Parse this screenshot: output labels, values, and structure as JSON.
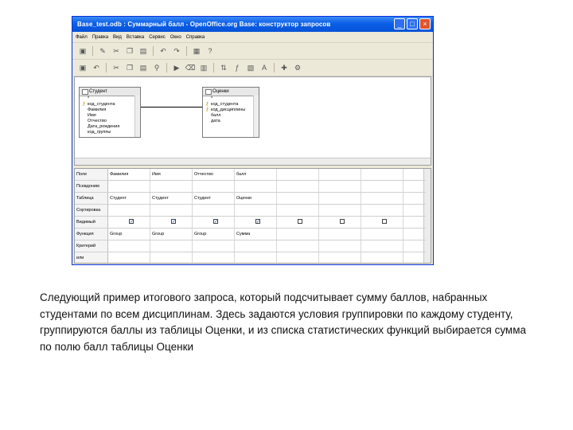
{
  "window": {
    "title": "Base_test.odb : Суммарный балл - OpenOffice.org Base: конструктор запросов",
    "buttons": [
      "_",
      "□",
      "×"
    ]
  },
  "menu": [
    "Файл",
    "Правка",
    "Вид",
    "Вставка",
    "Сервис",
    "Окно",
    "Справка"
  ],
  "design": {
    "table1": {
      "name": "Студент",
      "fields": [
        {
          "name": "*",
          "key": false
        },
        {
          "name": "код_студента",
          "key": true
        },
        {
          "name": "Фамилия",
          "key": false
        },
        {
          "name": "Имя",
          "key": false
        },
        {
          "name": "Отчество",
          "key": false
        },
        {
          "name": "Дата_рождения",
          "key": false
        },
        {
          "name": "код_группы",
          "key": false
        }
      ]
    },
    "table2": {
      "name": "Оценки",
      "fields": [
        {
          "name": "*",
          "key": false
        },
        {
          "name": "код_студента",
          "key": true
        },
        {
          "name": "код_дисциплины",
          "key": true
        },
        {
          "name": "балл",
          "key": false
        },
        {
          "name": "дата",
          "key": false
        }
      ]
    }
  },
  "grid": {
    "row_labels": [
      "Поле",
      "Псевдоним",
      "Таблица",
      "Сортировка",
      "Видимый",
      "Функция",
      "Критерий",
      "или"
    ],
    "columns": [
      {
        "field": "Фамилия",
        "table": "Студент",
        "visible": true,
        "function": "Group"
      },
      {
        "field": "Имя",
        "table": "Студент",
        "visible": true,
        "function": "Group"
      },
      {
        "field": "Отчество",
        "table": "Студент",
        "visible": true,
        "function": "Group"
      },
      {
        "field": "балл",
        "table": "Оценки",
        "visible": true,
        "function": "Сумма"
      },
      {
        "field": "",
        "table": "",
        "visible": false,
        "function": ""
      },
      {
        "field": "",
        "table": "",
        "visible": false,
        "function": ""
      },
      {
        "field": "",
        "table": "",
        "visible": false,
        "function": ""
      }
    ]
  },
  "caption": "Следующий пример итогового запроса, который подсчитывает сумму баллов, набранных студентами по всем дисциплинам. Здесь задаются условия группировки по каждому студенту, группируются баллы из таблицы Оценки, и из списка статистических функций выбирается сумма по полю балл таблицы Оценки"
}
